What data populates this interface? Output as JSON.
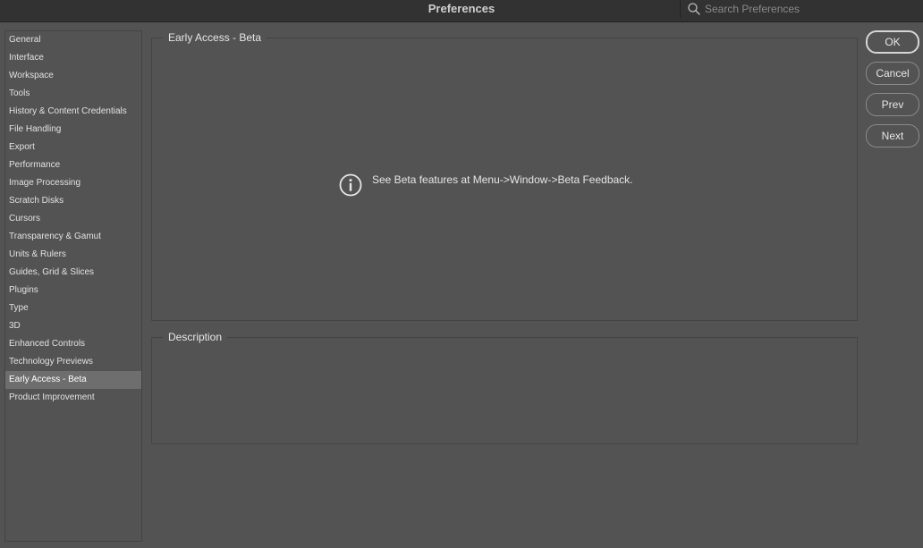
{
  "window": {
    "title": "Preferences"
  },
  "search": {
    "placeholder": "Search Preferences"
  },
  "sidebar": {
    "items": [
      {
        "label": "General"
      },
      {
        "label": "Interface"
      },
      {
        "label": "Workspace"
      },
      {
        "label": "Tools"
      },
      {
        "label": "History & Content Credentials"
      },
      {
        "label": "File Handling"
      },
      {
        "label": "Export"
      },
      {
        "label": "Performance"
      },
      {
        "label": "Image Processing"
      },
      {
        "label": "Scratch Disks"
      },
      {
        "label": "Cursors"
      },
      {
        "label": "Transparency & Gamut"
      },
      {
        "label": "Units & Rulers"
      },
      {
        "label": "Guides, Grid & Slices"
      },
      {
        "label": "Plugins"
      },
      {
        "label": "Type"
      },
      {
        "label": "3D"
      },
      {
        "label": "Enhanced Controls"
      },
      {
        "label": "Technology Previews"
      },
      {
        "label": "Early Access - Beta"
      },
      {
        "label": "Product Improvement"
      }
    ],
    "selected": "Early Access - Beta"
  },
  "panel": {
    "section_title": "Early Access - Beta",
    "info_message": "See Beta features at Menu->Window->Beta Feedback.",
    "description_title": "Description"
  },
  "buttons": {
    "ok": "OK",
    "cancel": "Cancel",
    "prev": "Prev",
    "next": "Next"
  },
  "icons": {
    "search": "search-icon",
    "info": "info-icon"
  }
}
